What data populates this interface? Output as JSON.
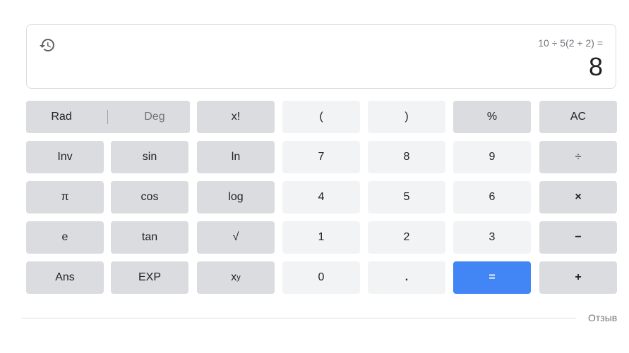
{
  "display": {
    "expression": "10 ÷ 5(2 + 2) =",
    "result": "8",
    "history_icon": "history-icon"
  },
  "keys": {
    "rad": "Rad",
    "deg": "Deg",
    "factorial": "x!",
    "lparen": "(",
    "rparen": ")",
    "percent": "%",
    "ac": "AC",
    "inv": "Inv",
    "sin": "sin",
    "ln": "ln",
    "n7": "7",
    "n8": "8",
    "n9": "9",
    "divide": "÷",
    "pi": "π",
    "cos": "cos",
    "log": "log",
    "n4": "4",
    "n5": "5",
    "n6": "6",
    "multiply": "×",
    "e": "e",
    "tan": "tan",
    "sqrt": "√",
    "n1": "1",
    "n2": "2",
    "n3": "3",
    "minus": "−",
    "ans": "Ans",
    "exp": "EXP",
    "power_base": "x",
    "power_sup": "y",
    "n0": "0",
    "dot": ".",
    "equals": "=",
    "plus": "+"
  },
  "footer": {
    "feedback": "Отзыв"
  },
  "colors": {
    "operator_key": "#dadce0",
    "number_key": "#f1f3f4",
    "equals_key": "#4285f4"
  }
}
